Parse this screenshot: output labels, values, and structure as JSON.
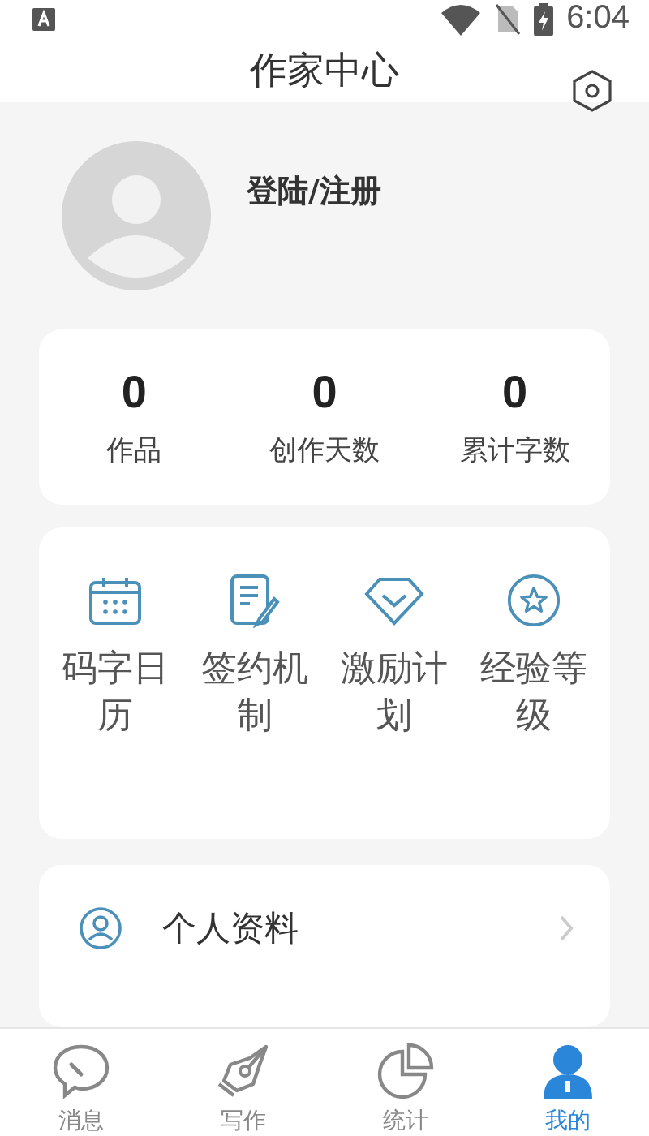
{
  "status_bar": {
    "time": "6:04"
  },
  "header": {
    "title": "作家中心"
  },
  "profile": {
    "login_label": "登陆/注册"
  },
  "stats": [
    {
      "value": "0",
      "label": "作品"
    },
    {
      "value": "0",
      "label": "创作天数"
    },
    {
      "value": "0",
      "label": "累计字数"
    }
  ],
  "tools": [
    {
      "kind": "calendar",
      "label": "码字日历"
    },
    {
      "kind": "contract",
      "label": "签约机制"
    },
    {
      "kind": "diamond",
      "label": "激励计划"
    },
    {
      "kind": "star",
      "label": "经验等级"
    }
  ],
  "menu": [
    {
      "label": "个人资料"
    }
  ],
  "tab_bar": [
    {
      "kind": "chat",
      "label": "消息",
      "selected": false
    },
    {
      "kind": "pen",
      "label": "写作",
      "selected": false
    },
    {
      "kind": "pie",
      "label": "统计",
      "selected": false
    },
    {
      "kind": "person",
      "label": "我的",
      "selected": true
    }
  ]
}
